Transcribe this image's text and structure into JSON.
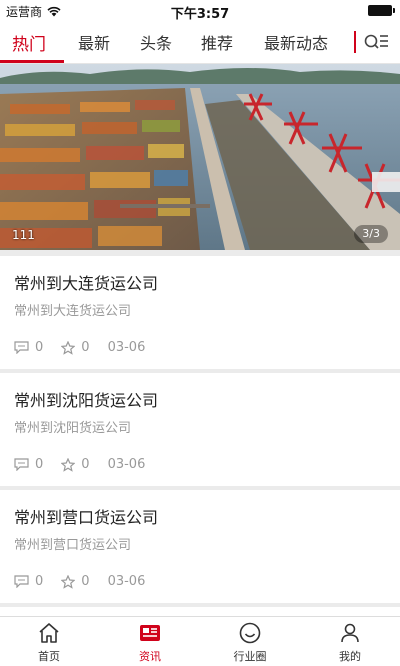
{
  "status_bar": {
    "carrier": "运营商",
    "time": "下午3:57"
  },
  "tabs": [
    {
      "label": "热门",
      "active": true
    },
    {
      "label": "最新",
      "active": false
    },
    {
      "label": "头条",
      "active": false
    },
    {
      "label": "推荐",
      "active": false
    },
    {
      "label": "最新动态",
      "active": false
    }
  ],
  "banner": {
    "caption": "111",
    "indicator": "3/3"
  },
  "articles": [
    {
      "title": "常州到大连货运公司",
      "subtitle": "常州到大连货运公司",
      "comments": "0",
      "favorites": "0",
      "date": "03-06"
    },
    {
      "title": "常州到沈阳货运公司",
      "subtitle": "常州到沈阳货运公司",
      "comments": "0",
      "favorites": "0",
      "date": "03-06"
    },
    {
      "title": "常州到营口货运公司",
      "subtitle": "常州到营口货运公司",
      "comments": "0",
      "favorites": "0",
      "date": "03-06"
    }
  ],
  "bottom_nav": [
    {
      "label": "首页",
      "icon": "home-icon",
      "active": false
    },
    {
      "label": "资讯",
      "icon": "news-icon",
      "active": true
    },
    {
      "label": "行业圈",
      "icon": "smile-icon",
      "active": false
    },
    {
      "label": "我的",
      "icon": "user-icon",
      "active": false
    }
  ],
  "colors": {
    "accent": "#d0021b",
    "muted_text": "#999999"
  }
}
